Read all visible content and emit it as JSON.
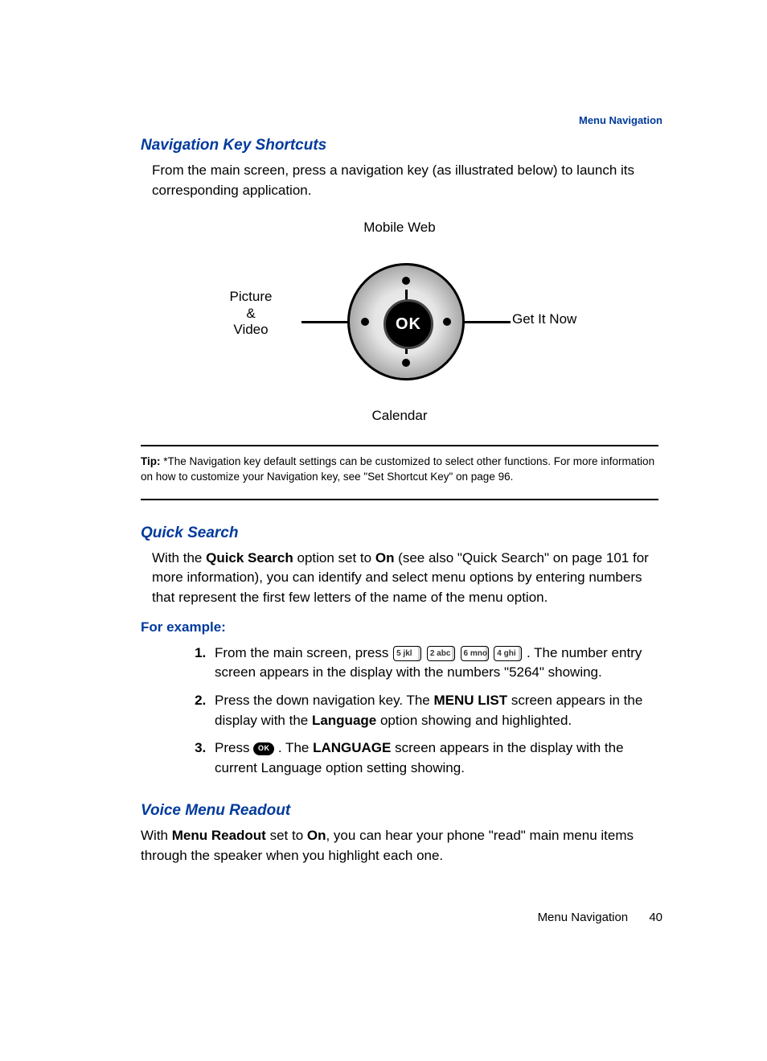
{
  "header_link": "Menu Navigation",
  "sections": {
    "nav_key_shortcuts": {
      "title": "Navigation Key Shortcuts",
      "body": "From the main screen, press a navigation key (as illustrated below) to launch its corresponding application."
    },
    "diagram": {
      "top": "Mobile Web",
      "left_l1": "Picture",
      "left_l2": "&",
      "left_l3": "Video",
      "right": "Get It Now",
      "bottom": "Calendar",
      "center": "OK"
    },
    "tip": {
      "label": "Tip:",
      "text": "*The Navigation key default settings can be customized to select other functions. For more information on how to customize your Navigation key, see \"Set Shortcut Key\" on page 96."
    },
    "quick_search": {
      "title": "Quick Search",
      "body_pre": "With the ",
      "body_bold1": "Quick Search",
      "body_mid1": " option set to ",
      "body_bold2": "On",
      "body_post": " (see also \"Quick Search\" on page 101 for more information), you can identify and select menu options by entering numbers that represent the first few letters of the name of the menu option.",
      "example_heading": "For example:",
      "steps": {
        "s1_pre": "From the main screen, press ",
        "s1_keys": [
          "5 jkl",
          "2 abc",
          "6 mno",
          "4 ghi"
        ],
        "s1_post": ". The number entry screen appears in the display with the numbers \"5264\" showing.",
        "s2_pre": "Press the down navigation key. The ",
        "s2_b1": "MENU LIST",
        "s2_mid": " screen appears in the display with the ",
        "s2_b2": "Language",
        "s2_post": " option showing and highlighted.",
        "s3_pre": "Press ",
        "s3_ok": "OK",
        "s3_mid": ". The ",
        "s3_b1": "LANGUAGE",
        "s3_post": " screen appears in the display with the current Language option setting showing."
      }
    },
    "voice_menu": {
      "title": "Voice Menu Readout",
      "body_pre": "With ",
      "body_b1": "Menu Readout",
      "body_mid1": " set to ",
      "body_b2": "On",
      "body_post": ", you can hear your phone \"read\" main menu items through the speaker when you highlight each one."
    }
  },
  "footer": {
    "section": "Menu Navigation",
    "page": "40"
  }
}
